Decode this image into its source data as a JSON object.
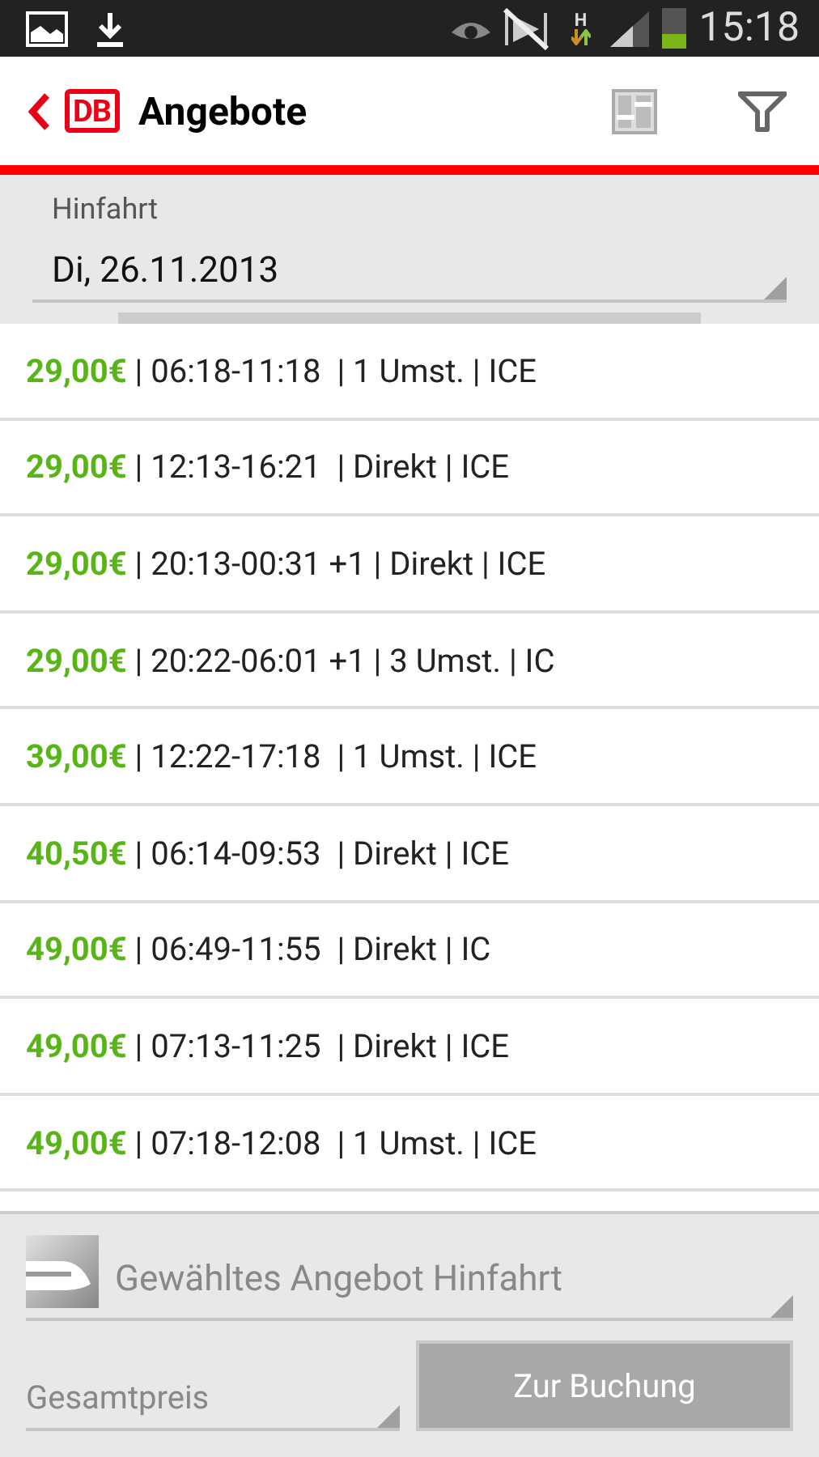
{
  "status_bar": {
    "network": "H",
    "time": "15:18"
  },
  "app_bar": {
    "logo": "DB",
    "title": "Angebote"
  },
  "journey": {
    "label": "Hinfahrt",
    "date": "Di, 26.11.2013"
  },
  "offers": [
    {
      "price": "29,00€",
      "details": "| 06:18-11:18  | 1 Umst. | ICE"
    },
    {
      "price": "29,00€",
      "details": "| 12:13-16:21  | Direkt | ICE"
    },
    {
      "price": "29,00€",
      "details": "| 20:13-00:31 +1 | Direkt | ICE"
    },
    {
      "price": "29,00€",
      "details": "| 20:22-06:01 +1 | 3 Umst. | IC"
    },
    {
      "price": "39,00€",
      "details": "| 12:22-17:18  | 1 Umst. | ICE"
    },
    {
      "price": "40,50€",
      "details": "| 06:14-09:53  | Direkt | ICE"
    },
    {
      "price": "49,00€",
      "details": "| 06:49-11:55  | Direkt | IC"
    },
    {
      "price": "49,00€",
      "details": "| 07:13-11:25  | Direkt | ICE"
    },
    {
      "price": "49,00€",
      "details": "| 07:18-12:08  | 1 Umst. | ICE"
    }
  ],
  "footer": {
    "selected_offer": "Gewähltes Angebot Hinfahrt",
    "total": "Gesamtpreis",
    "book_button": {
      "label": "Zur Buchung",
      "disabled": true
    }
  }
}
